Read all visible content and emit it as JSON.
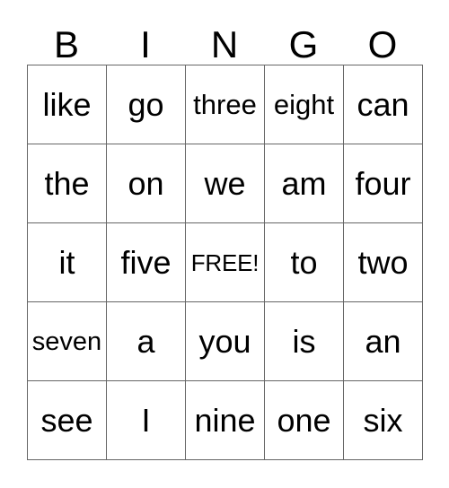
{
  "card": {
    "title_letters": [
      "B",
      "I",
      "N",
      "G",
      "O"
    ],
    "free_space_label": "FREE!",
    "grid_line_color": "#666666",
    "text_color": "#000000",
    "background_color": "#ffffff",
    "rows": [
      [
        "like",
        "go",
        "three",
        "eight",
        "can"
      ],
      [
        "the",
        "on",
        "we",
        "am",
        "four"
      ],
      [
        "it",
        "five",
        "FREE!",
        "to",
        "two"
      ],
      [
        "seven",
        "a",
        "you",
        "is",
        "an"
      ],
      [
        "see",
        "I",
        "nine",
        "one",
        "six"
      ]
    ]
  }
}
